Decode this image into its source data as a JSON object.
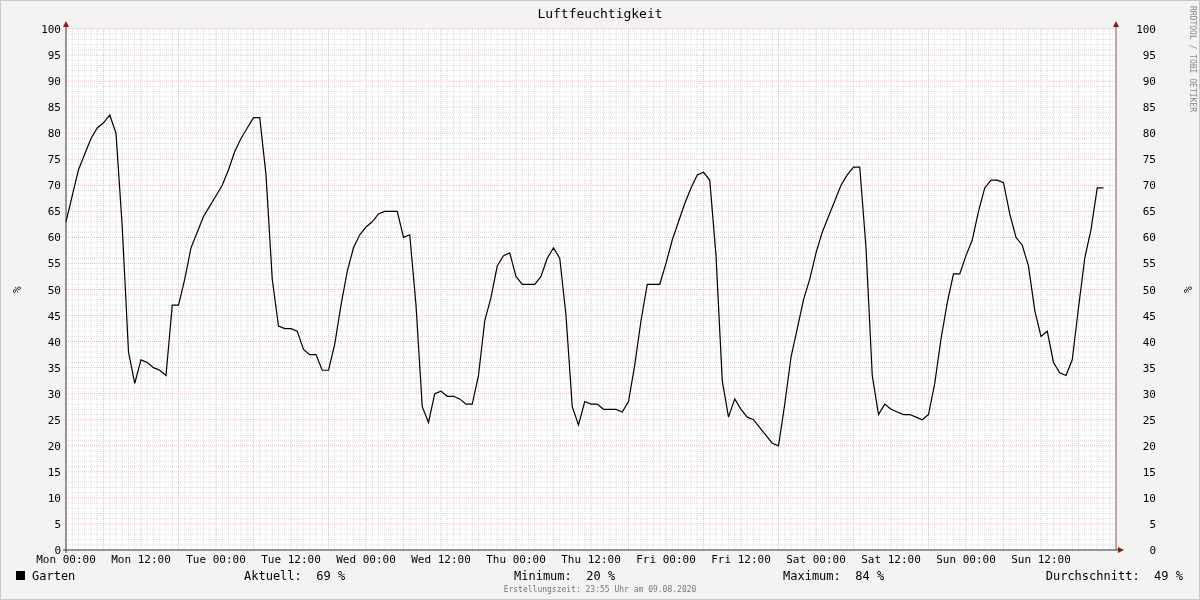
{
  "title": "Luftfeuchtigkeit",
  "chart_data": {
    "type": "line",
    "grid": true,
    "ylabel": "%",
    "ylim": [
      0,
      100
    ],
    "yticks": [
      0,
      5,
      10,
      15,
      20,
      25,
      30,
      35,
      40,
      45,
      50,
      55,
      60,
      65,
      70,
      75,
      80,
      85,
      90,
      95,
      100
    ],
    "categories": [
      "Mon 00:00",
      null,
      null,
      null,
      null,
      null,
      null,
      null,
      null,
      null,
      null,
      null,
      "Mon 12:00",
      null,
      null,
      null,
      null,
      null,
      null,
      null,
      null,
      null,
      null,
      null,
      "Tue 00:00",
      null,
      null,
      null,
      null,
      null,
      null,
      null,
      null,
      null,
      null,
      null,
      "Tue 12:00",
      null,
      null,
      null,
      null,
      null,
      null,
      null,
      null,
      null,
      null,
      null,
      "Wed 00:00",
      null,
      null,
      null,
      null,
      null,
      null,
      null,
      null,
      null,
      null,
      null,
      "Wed 12:00",
      null,
      null,
      null,
      null,
      null,
      null,
      null,
      null,
      null,
      null,
      null,
      "Thu 00:00",
      null,
      null,
      null,
      null,
      null,
      null,
      null,
      null,
      null,
      null,
      null,
      "Thu 12:00",
      null,
      null,
      null,
      null,
      null,
      null,
      null,
      null,
      null,
      null,
      null,
      "Fri 00:00",
      null,
      null,
      null,
      null,
      null,
      null,
      null,
      null,
      null,
      null,
      null,
      "Fri 12:00",
      null,
      null,
      null,
      null,
      null,
      null,
      null,
      null,
      null,
      null,
      null,
      "Sat 00:00",
      null,
      null,
      null,
      null,
      null,
      null,
      null,
      null,
      null,
      null,
      null,
      "Sat 12:00",
      null,
      null,
      null,
      null,
      null,
      null,
      null,
      null,
      null,
      null,
      null,
      "Sun 00:00",
      null,
      null,
      null,
      null,
      null,
      null,
      null,
      null,
      null,
      null,
      null,
      "Sun 12:00",
      null,
      null,
      null,
      null,
      null,
      null,
      null,
      null,
      null,
      null
    ],
    "series": [
      {
        "name": "Garten",
        "color": "#000000",
        "values": [
          63,
          68,
          73,
          76,
          79,
          81,
          82,
          83.5,
          80,
          62,
          38,
          32,
          36.5,
          36,
          35,
          34.5,
          33.5,
          47,
          47,
          52,
          58,
          61,
          64,
          66,
          68,
          70,
          73,
          76.5,
          79,
          81,
          83,
          83,
          72,
          52,
          43,
          42.5,
          42.5,
          42,
          38.5,
          37.5,
          37.5,
          34.5,
          34.5,
          39.5,
          47,
          53.5,
          58,
          60.5,
          62,
          63,
          64.5,
          65,
          65,
          65,
          60,
          60.5,
          47,
          27.5,
          24.5,
          30,
          30.5,
          29.5,
          29.5,
          29,
          28,
          28,
          33.5,
          44,
          48.5,
          54.5,
          56.5,
          57,
          52.5,
          51,
          51,
          51,
          52.5,
          56,
          58,
          56,
          45,
          27.5,
          24,
          28.5,
          28,
          28,
          27,
          27,
          27,
          26.5,
          28.5,
          35.5,
          44,
          51,
          51,
          51,
          55,
          59.5,
          63,
          66.5,
          69.5,
          72,
          72.5,
          71,
          56.5,
          32.5,
          25.5,
          29,
          27,
          25.5,
          25,
          23.5,
          22,
          20.5,
          20,
          28,
          37,
          42.5,
          48,
          52,
          57,
          61,
          64,
          67,
          70,
          72,
          73.5,
          73.5,
          58,
          33.5,
          26,
          28,
          27,
          26.5,
          26,
          26,
          25.5,
          25,
          26,
          32,
          40.5,
          47.5,
          53,
          53,
          56.5,
          59.5,
          65,
          69.5,
          71,
          71,
          70.5,
          64.5,
          60,
          58.5,
          54.5,
          46,
          41,
          42,
          36,
          34,
          33.5,
          36.5,
          46.5,
          56,
          61.5,
          69.5,
          69.5
        ]
      }
    ]
  },
  "right_axis": {
    "ylabel": "%",
    "ticks": [
      "100",
      "95",
      "90",
      "85",
      "80",
      "75",
      "70",
      "65",
      "60",
      "55",
      "50",
      "45",
      "40",
      "35",
      "30",
      "25",
      "20",
      "15",
      "10",
      "5",
      "0"
    ]
  },
  "credit": "RRDTOOL / TOBI OETIKER",
  "stats": [
    {
      "label": "Aktuell:",
      "value": "69 %"
    },
    {
      "label": "Minimum:",
      "value": "20 %"
    },
    {
      "label": "Maximum:",
      "value": "84 %"
    },
    {
      "label": "Durchschnitt:",
      "value": "49 %"
    }
  ],
  "footer": "Erstellungszeit: 23:55 Uhr am 09.08.2020"
}
